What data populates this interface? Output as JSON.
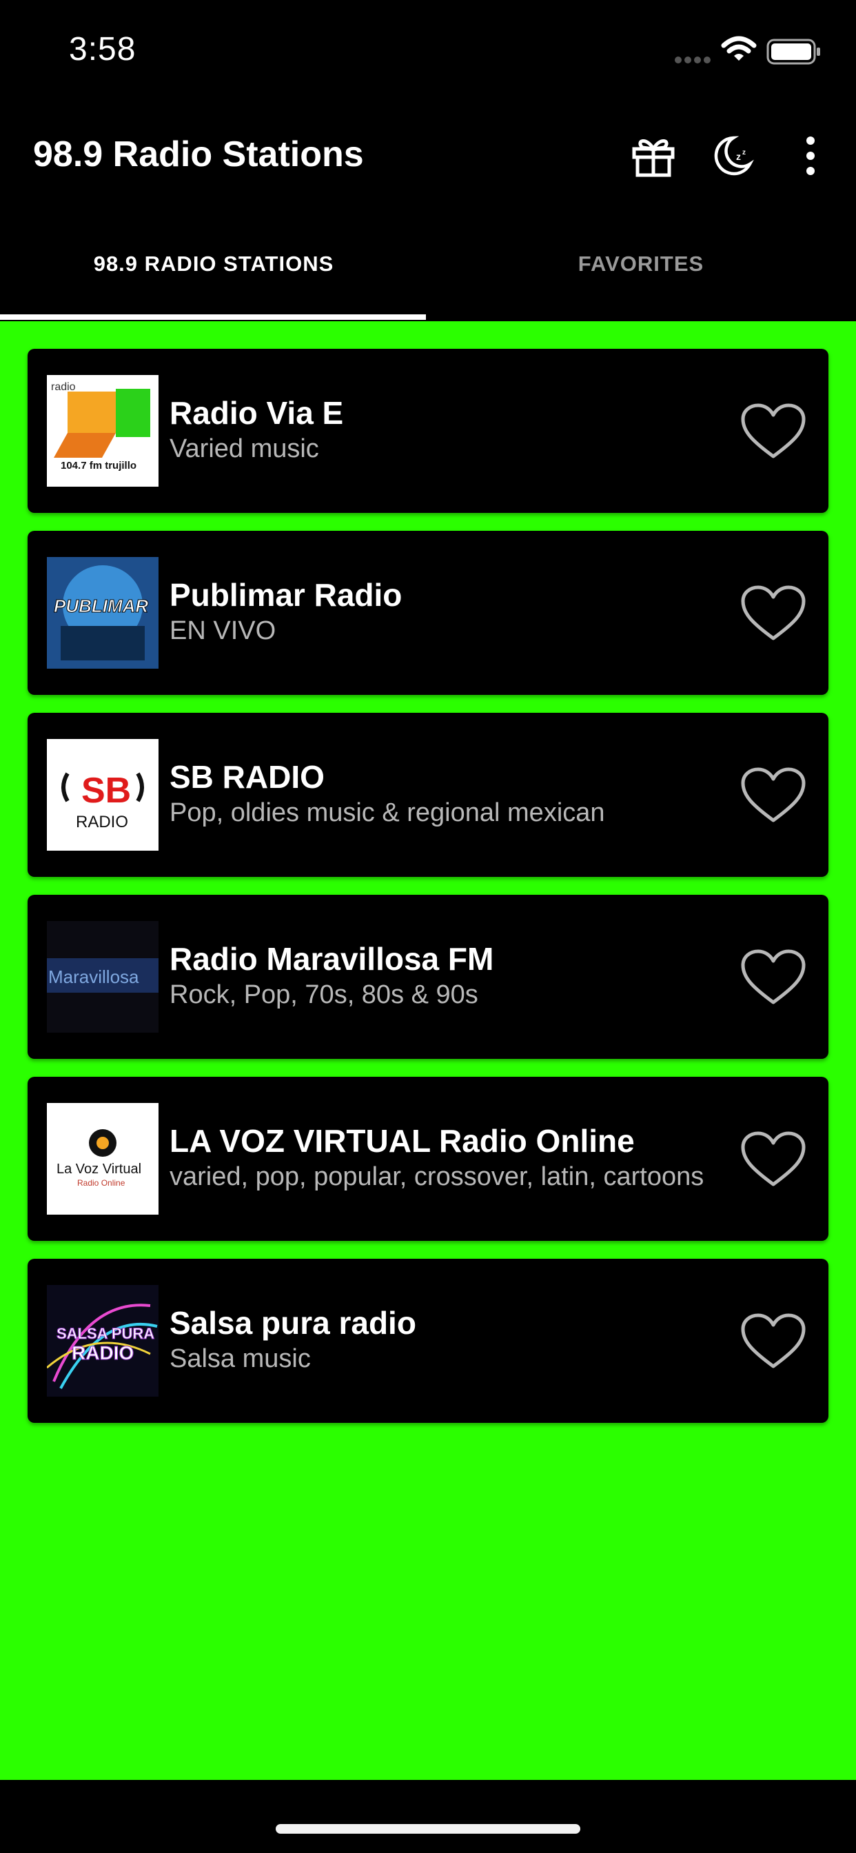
{
  "status_bar": {
    "time": "3:58",
    "icons": [
      "cellular-signal-icon",
      "wifi-icon",
      "battery-icon"
    ]
  },
  "app_bar": {
    "title": "98.9 Radio Stations",
    "actions": [
      "gift-icon",
      "night-mode-icon",
      "more-vert-icon"
    ]
  },
  "tabs": [
    {
      "label": "98.9 RADIO STATIONS",
      "active": true
    },
    {
      "label": "FAVORITES",
      "active": false
    }
  ],
  "colors": {
    "background": "#2bff00",
    "card": "#000000",
    "text_primary": "#ffffff",
    "text_secondary": "#b8b8b8",
    "tab_inactive": "#9a9a9a"
  },
  "stations": [
    {
      "name": "Radio Via E",
      "genre": "Varied music",
      "logo": "radio-via-e-logo",
      "logo_text": [
        "radio",
        "104.7 fm trujillo"
      ],
      "favorite": false
    },
    {
      "name": "Publimar Radio",
      "genre": "EN VIVO",
      "logo": "publimar-radio-logo",
      "logo_text": [
        "PUBLIMAR"
      ],
      "favorite": false
    },
    {
      "name": "SB RADIO",
      "genre": "Pop, oldies music & regional mexican",
      "logo": "sb-radio-logo",
      "logo_text": [
        "SB",
        "RADIO"
      ],
      "favorite": false
    },
    {
      "name": "Radio Maravillosa FM",
      "genre": "Rock, Pop, 70s, 80s & 90s",
      "logo": "radio-maravillosa-logo",
      "logo_text": [
        "Maravillosa"
      ],
      "favorite": false
    },
    {
      "name": "LA VOZ VIRTUAL Radio Online",
      "genre": "varied, pop, popular, crossover, latin, cartoons",
      "logo": "la-voz-virtual-logo",
      "logo_text": [
        "La Voz Virtual",
        "Radio Online"
      ],
      "favorite": false
    },
    {
      "name": "Salsa pura radio",
      "genre": "Salsa music",
      "logo": "salsa-pura-radio-logo",
      "logo_text": [
        "SALSA PURA",
        "RADIO"
      ],
      "favorite": false
    }
  ]
}
